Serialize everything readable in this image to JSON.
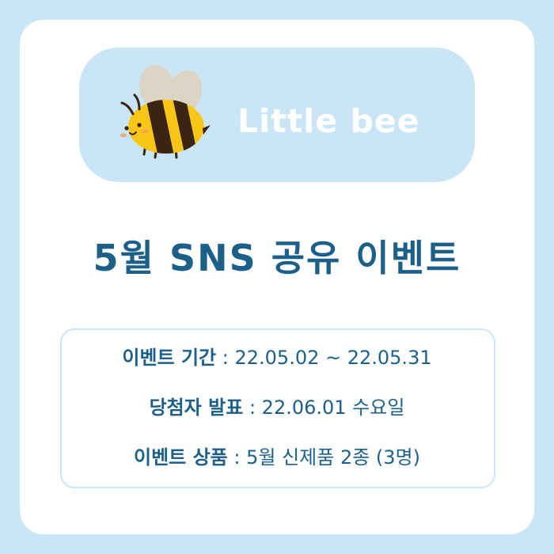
{
  "brand": {
    "name": "Little bee",
    "mascot_icon": "bee-icon"
  },
  "headline": "5월 SNS 공유 이벤트",
  "details": [
    {
      "label": "이벤트 기간",
      "separator": " : ",
      "value": "22.05.02 ~ 22.05.31"
    },
    {
      "label": "당첨자 발표",
      "separator": " : ",
      "value": "22.06.01 수요일"
    },
    {
      "label": "이벤트 상품",
      "separator": " : ",
      "value": "5월 신제품 2종 (3명)"
    }
  ],
  "colors": {
    "background": "#c9e5f6",
    "card": "#ffffff",
    "text": "#1c5f88",
    "bee_yellow": "#f9c517",
    "bee_stripe": "#3a2414"
  }
}
